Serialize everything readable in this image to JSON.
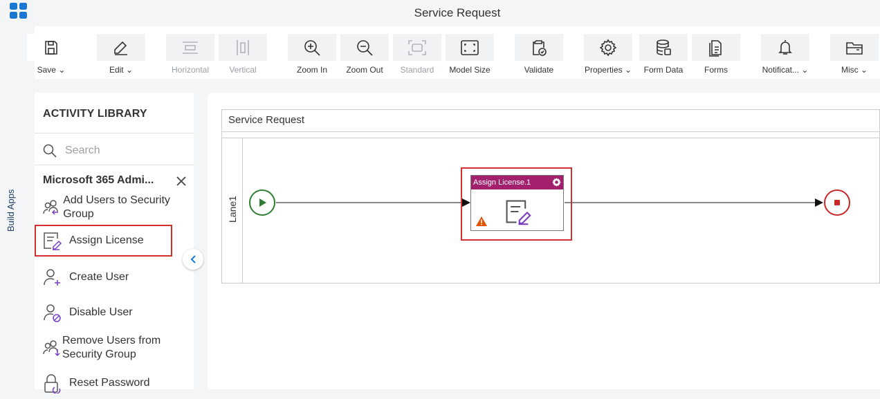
{
  "app": {
    "title": "Service Request",
    "rail_label": "Build Apps"
  },
  "toolbar": {
    "items": [
      {
        "label": "Save",
        "icon": "save-icon",
        "dropdown": true,
        "disabled": false
      },
      {
        "label": "Edit",
        "icon": "edit-icon",
        "dropdown": true,
        "disabled": false
      },
      {
        "label": "Horizontal",
        "icon": "horizontal-icon",
        "dropdown": false,
        "disabled": true
      },
      {
        "label": "Vertical",
        "icon": "vertical-icon",
        "dropdown": false,
        "disabled": true
      },
      {
        "label": "Zoom In",
        "icon": "zoom-in-icon",
        "dropdown": false,
        "disabled": false
      },
      {
        "label": "Zoom Out",
        "icon": "zoom-out-icon",
        "dropdown": false,
        "disabled": false
      },
      {
        "label": "Standard",
        "icon": "standard-icon",
        "dropdown": false,
        "disabled": true
      },
      {
        "label": "Model Size",
        "icon": "model-size-icon",
        "dropdown": false,
        "disabled": false
      },
      {
        "label": "Validate",
        "icon": "validate-icon",
        "dropdown": false,
        "disabled": false
      },
      {
        "label": "Properties",
        "icon": "gear-icon",
        "dropdown": true,
        "disabled": false
      },
      {
        "label": "Form Data",
        "icon": "database-icon",
        "dropdown": false,
        "disabled": false
      },
      {
        "label": "Forms",
        "icon": "forms-icon",
        "dropdown": false,
        "disabled": false
      },
      {
        "label": "Notificat...",
        "icon": "bell-icon",
        "dropdown": true,
        "disabled": false
      },
      {
        "label": "Misc",
        "icon": "folder-icon",
        "dropdown": true,
        "disabled": false
      }
    ]
  },
  "library": {
    "title": "ACTIVITY LIBRARY",
    "search_placeholder": "Search",
    "category": "Microsoft 365 Admi...",
    "items": [
      {
        "label": "Add Users to Security Group",
        "icon": "add-users-group-icon"
      },
      {
        "label": "Assign License",
        "icon": "assign-license-icon",
        "selected": true
      },
      {
        "label": "Create User",
        "icon": "create-user-icon"
      },
      {
        "label": "Disable User",
        "icon": "disable-user-icon"
      },
      {
        "label": "Remove Users from Security Group",
        "icon": "remove-users-group-icon"
      },
      {
        "label": "Reset Password",
        "icon": "reset-password-icon"
      }
    ]
  },
  "canvas": {
    "pool_title": "Service Request",
    "lane_label": "Lane1",
    "task": {
      "title": "Assign License.1",
      "warning": true
    }
  },
  "colors": {
    "task_header": "#a3206f",
    "start_event": "#2e7d32",
    "end_event": "#c62828",
    "highlight": "#d32f2f",
    "accent_blue": "#1976d2"
  }
}
